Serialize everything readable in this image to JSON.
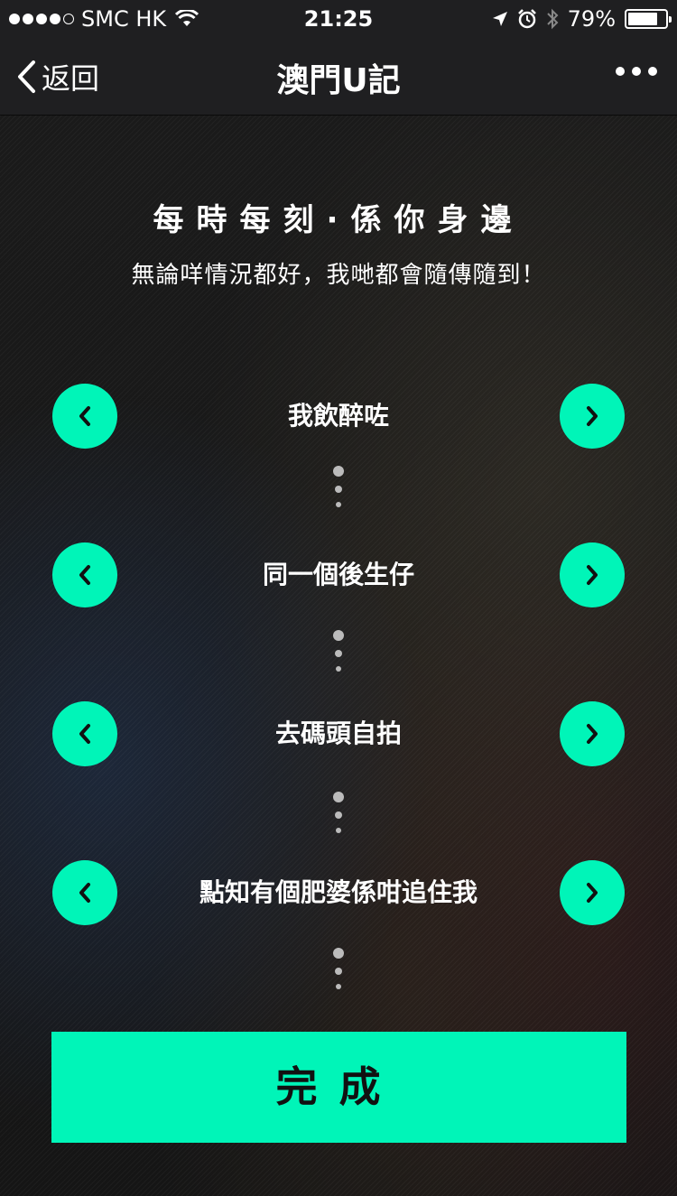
{
  "status_bar": {
    "carrier": "SMC HK",
    "time": "21:25",
    "battery": "79%",
    "battery_level": 0.79,
    "icons": [
      "signal-dots",
      "wifi-icon",
      "location-icon",
      "alarm-icon",
      "bluetooth-icon",
      "battery-icon"
    ]
  },
  "nav": {
    "back_label": "返回",
    "title": "澳門U記"
  },
  "hero": {
    "headline": "每時每刻·係你身邊",
    "subline": "無論咩情況都好，我哋都會隨傳隨到！"
  },
  "options": [
    {
      "label": "我飲醉咗"
    },
    {
      "label": "同一個後生仔"
    },
    {
      "label": "去碼頭自拍"
    },
    {
      "label": "點知有個肥婆係咁追住我"
    }
  ],
  "done_button": {
    "label": "完成"
  },
  "colors": {
    "accent": "#00f5b8",
    "bar_background": "#1f1f21"
  }
}
